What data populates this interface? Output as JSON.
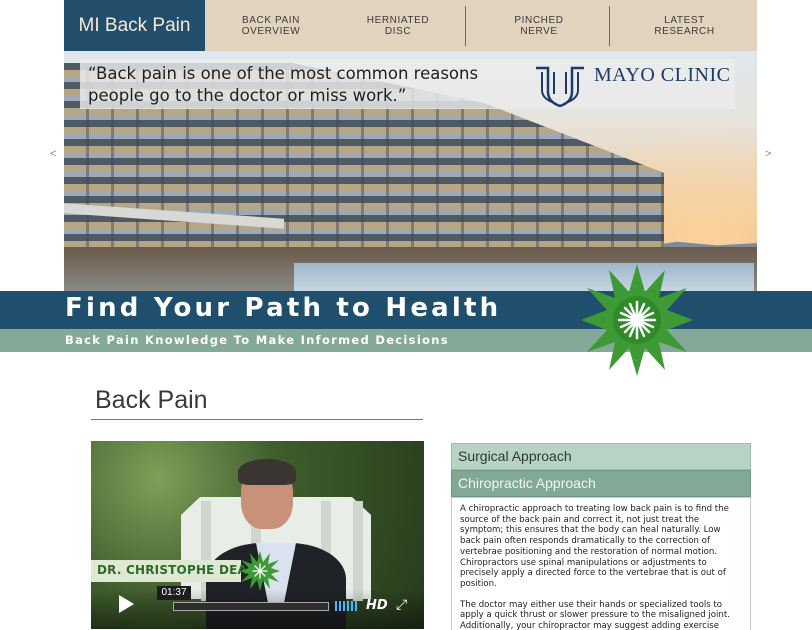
{
  "nav": {
    "brand": "MI Back Pain",
    "items": [
      {
        "label": "BACK PAIN\nOVERVIEW"
      },
      {
        "label": "HERNIATED\nDISC"
      },
      {
        "label": "PINCHED\nNERVE"
      },
      {
        "label": "LATEST\nRESEARCH"
      }
    ]
  },
  "hero": {
    "quote": "“Back pain is one of the most common reasons people go to the doctor or miss work.”",
    "logo_text": "MAYO CLINIC",
    "prev_arrow": "<",
    "next_arrow": ">"
  },
  "banner": {
    "title": "Find Your Path to Health",
    "subtitle": "Back Pain Knowledge To Make Informed Decisions"
  },
  "page": {
    "title": "Back Pain"
  },
  "video": {
    "name_plate": "DR. CHRISTOPHE DEAN",
    "time": "01:37",
    "progress": 0.0,
    "hd_label": "HD"
  },
  "accordion": {
    "sections": [
      {
        "label": "Surgical Approach",
        "expanded": false
      },
      {
        "label": "Chiropractic Approach",
        "expanded": true
      }
    ],
    "paragraphs": [
      "A chiropractic approach to treating low back pain is to find the source of the back pain and correct it, not just treat the symptom; this ensures that the body can heal naturally. Low back pain often responds dramatically to the correction of vertebrae positioning and the restoration of normal motion. Chiropractors use spinal manipulations or adjustments to precisely apply a directed force to the vertebrae that is out of position.",
      "The doctor may either use their hands or specialized tools to apply a quick thrust or slower pressure to the misaligned joint. Additionally, your chiropractor may suggest adding exercise"
    ]
  },
  "colors": {
    "brand_blue": "#224d6b",
    "nav_beige": "#e2d3bf",
    "banner_blue": "#1f4f6c",
    "banner_green": "#84a998",
    "star_green": "#3d9a34"
  }
}
